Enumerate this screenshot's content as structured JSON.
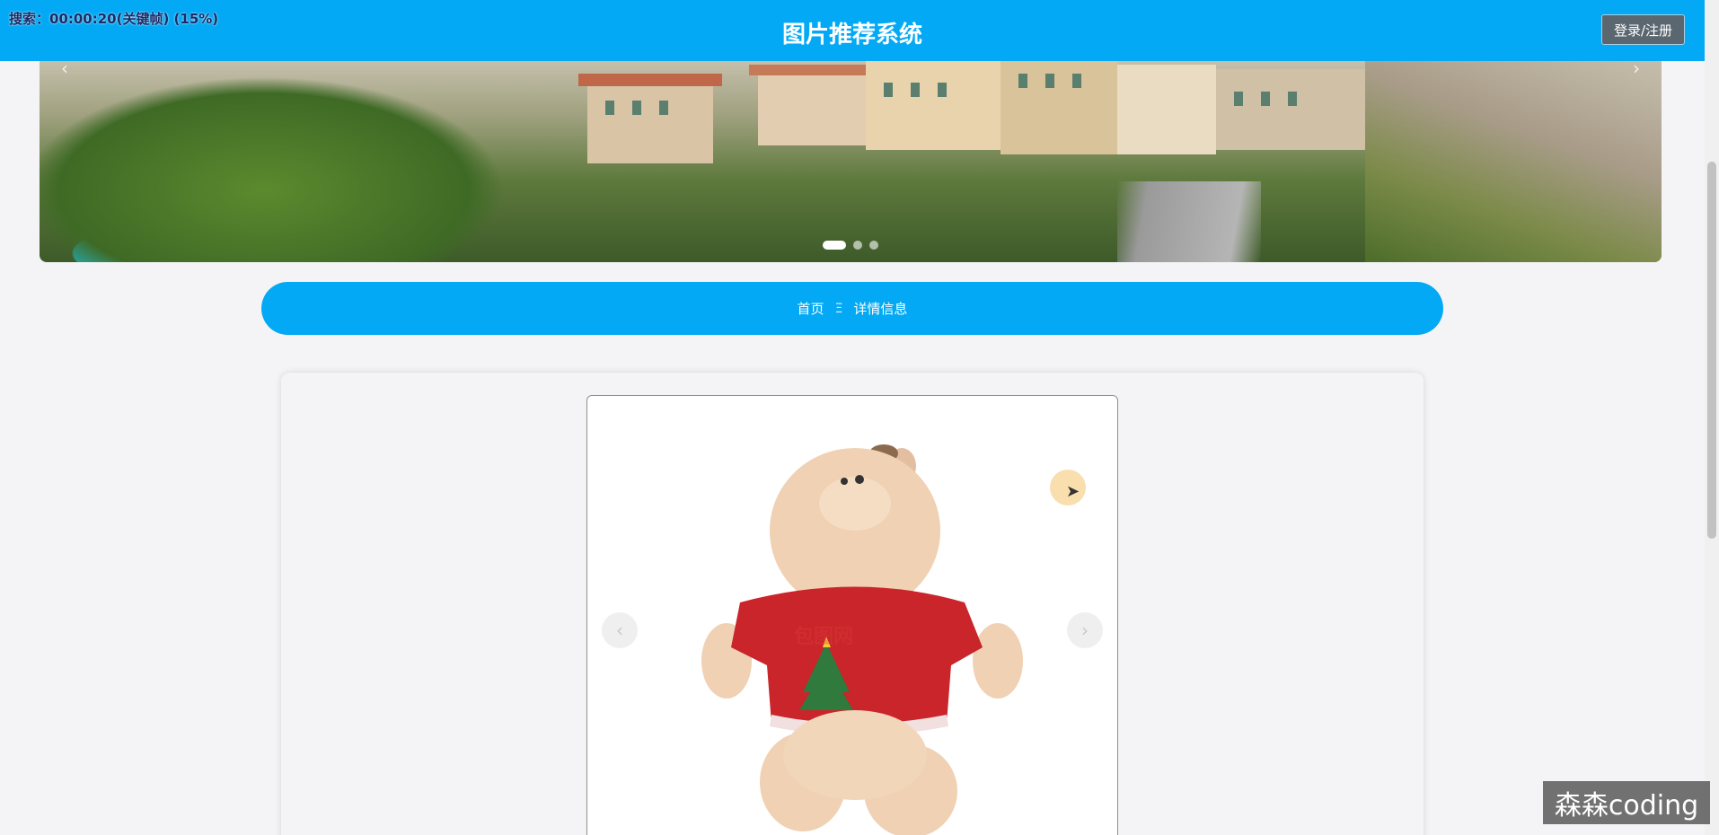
{
  "recording_overlay": "搜索：00:00:20(关键帧) (15%)",
  "header": {
    "title": "图片推荐系统",
    "login_label": "登录/注册"
  },
  "banner": {
    "slide_count": 3,
    "active_index": 0
  },
  "breadcrumb": {
    "home": "首页",
    "separator": "Ξ",
    "current": "详情信息"
  },
  "detail": {
    "image_watermark": "包图网",
    "prev_label": "‹",
    "next_label": "›"
  },
  "corner_watermark": "森森coding",
  "colors": {
    "primary": "#03a9f4",
    "background": "#f4f4f6"
  }
}
